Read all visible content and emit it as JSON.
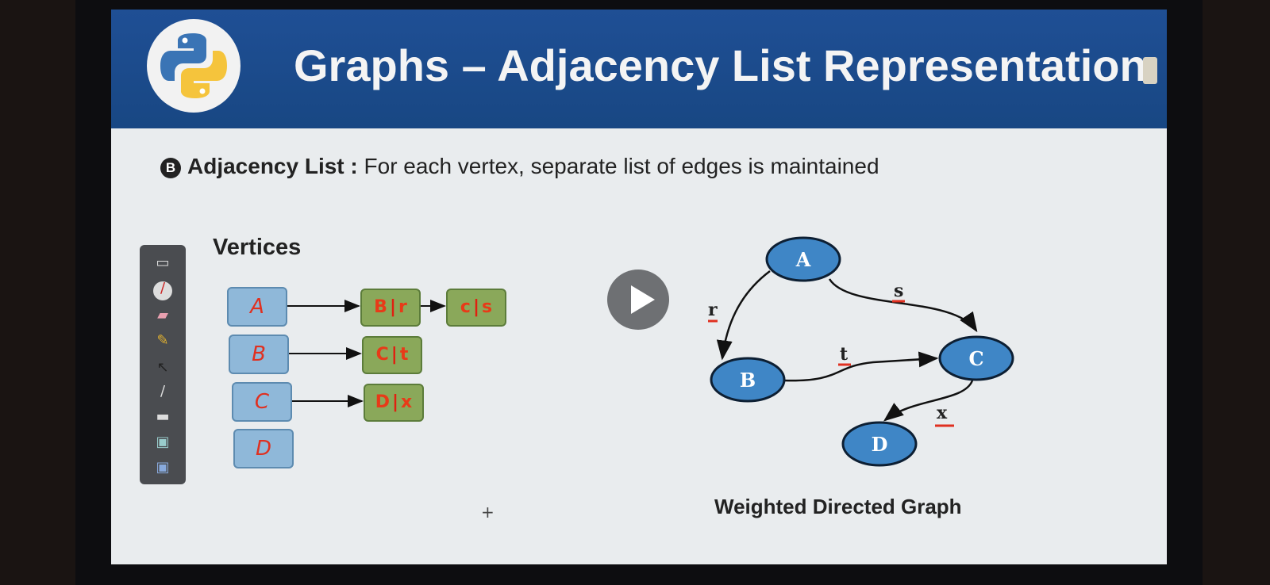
{
  "header": {
    "title": "Graphs – Adjacency List Representation",
    "logo": "python-logo"
  },
  "subtitle": {
    "badge": "B",
    "term": "Adjacency List :",
    "text": "For each vertex, separate list of edges is maintained"
  },
  "vertices": {
    "title": "Vertices",
    "items": [
      {
        "label": "A",
        "edges": [
          {
            "to": "B",
            "w": "r"
          },
          {
            "to": "c",
            "w": "s"
          }
        ]
      },
      {
        "label": "B",
        "edges": [
          {
            "to": "C",
            "w": "t"
          }
        ]
      },
      {
        "label": "C",
        "edges": [
          {
            "to": "D",
            "w": "x"
          }
        ]
      },
      {
        "label": "D",
        "edges": []
      }
    ]
  },
  "graph": {
    "caption": "Weighted Directed Graph",
    "nodes": [
      "A",
      "B",
      "C",
      "D"
    ],
    "edges": [
      {
        "from": "A",
        "to": "B",
        "w": "r"
      },
      {
        "from": "A",
        "to": "C",
        "w": "s"
      },
      {
        "from": "B",
        "to": "C",
        "w": "t"
      },
      {
        "from": "C",
        "to": "D",
        "w": "x"
      }
    ],
    "colors": {
      "node": "#3f86c6",
      "node_border": "#0d1f33",
      "weight_underline": "#e03020"
    }
  },
  "toolbar": {
    "tools": [
      "whiteboard-icon",
      "pen-icon",
      "eraser-icon",
      "highlighter-icon",
      "pointer-icon",
      "marker-icon",
      "line-icon",
      "screen-icon",
      "capture-icon"
    ]
  },
  "video": {
    "control": "play-icon"
  }
}
